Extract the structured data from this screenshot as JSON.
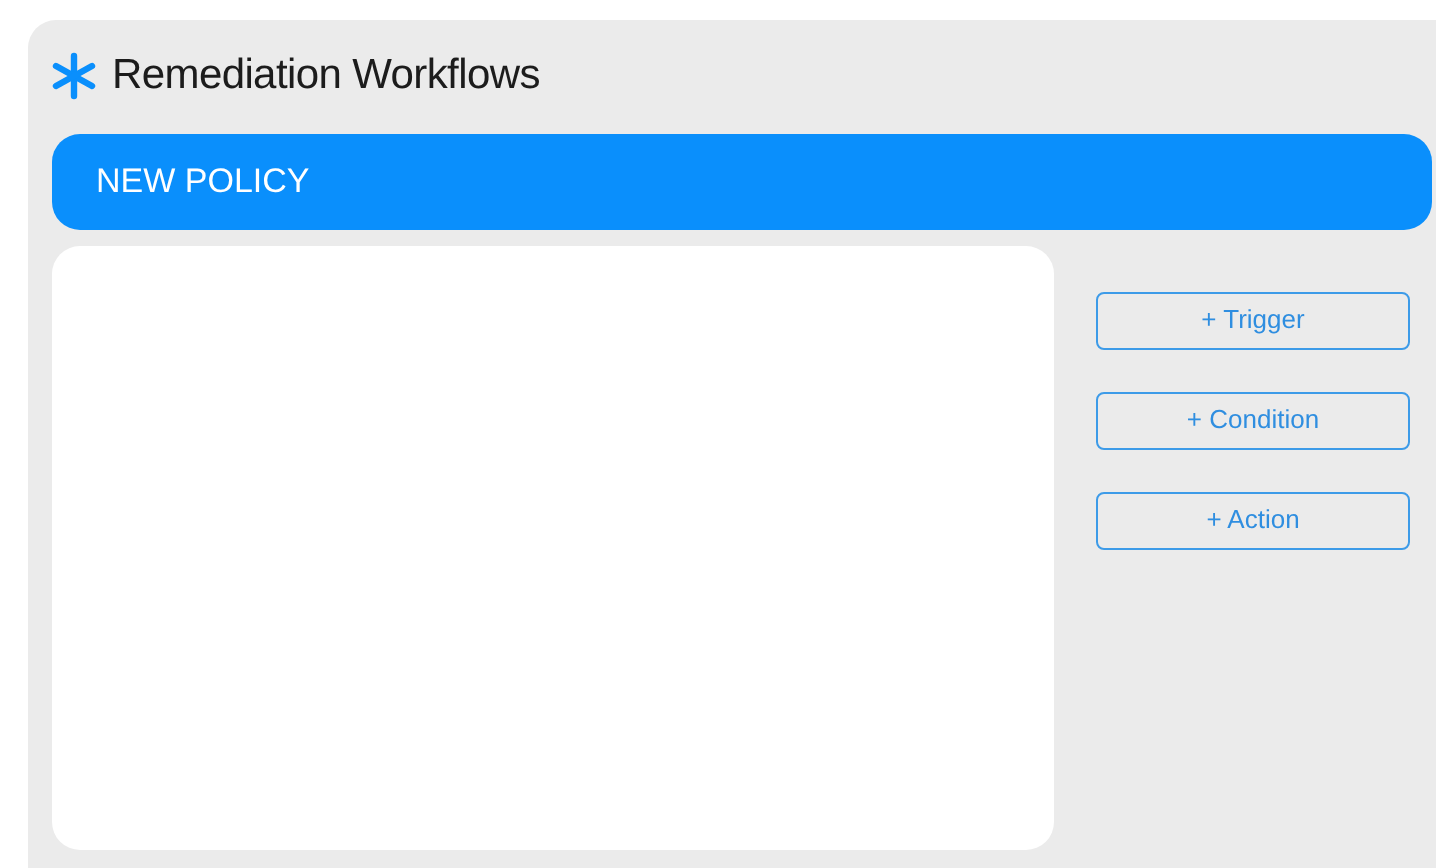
{
  "window": {
    "title": "Remediation Workflows"
  },
  "header_bar": {
    "title": "NEW POLICY"
  },
  "buttons": [
    {
      "label": "+ Trigger"
    },
    {
      "label": "+ Condition"
    },
    {
      "label": "+ Action"
    }
  ]
}
